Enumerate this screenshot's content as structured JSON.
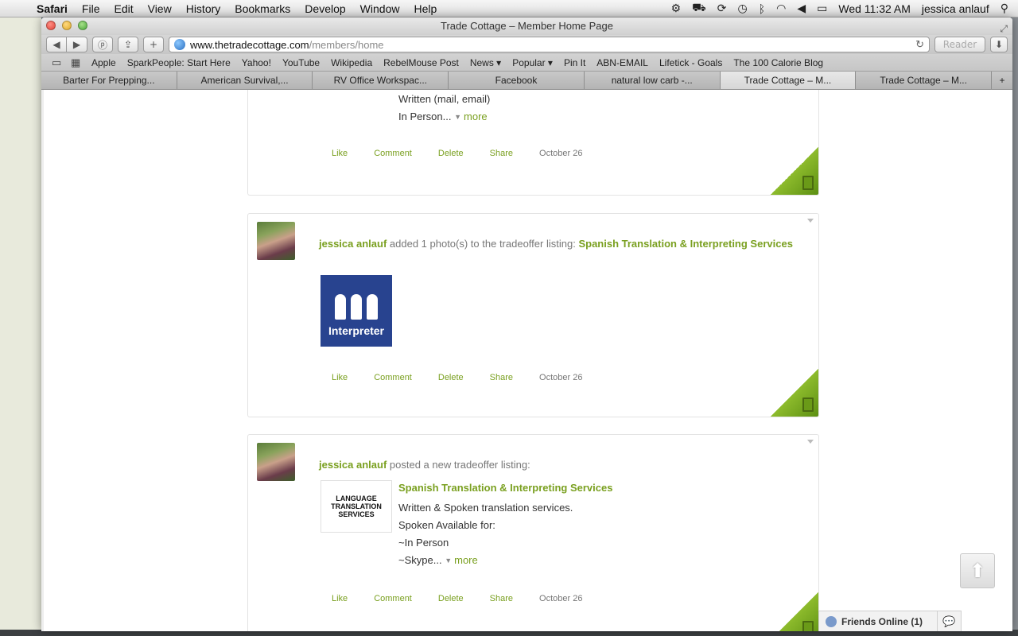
{
  "menubar": {
    "app": "Safari",
    "menus": [
      "File",
      "Edit",
      "View",
      "History",
      "Bookmarks",
      "Develop",
      "Window",
      "Help"
    ],
    "clock": "Wed 11:32 AM",
    "user": "jessica anlauf"
  },
  "window": {
    "title": "Trade Cottage – Member Home Page"
  },
  "toolbar": {
    "url_host": "www.thetradecottage.com",
    "url_path": "/members/home",
    "reader_label": "Reader"
  },
  "bookmarks": [
    "Apple",
    "SparkPeople: Start Here",
    "Yahoo!",
    "YouTube",
    "Wikipedia",
    "RebelMouse Post",
    "News ▾",
    "Popular ▾",
    "Pin It",
    "ABN-EMAIL",
    "Lifetick - Goals",
    "The 100 Calorie Blog"
  ],
  "tabs": [
    "Barter For Prepping...",
    "American Survival,...",
    "RV Office Workspac...",
    "Facebook",
    "natural low carb -...",
    "Trade Cottage – M...",
    "Trade Cottage – M..."
  ],
  "feed": {
    "post1": {
      "lines": [
        "Written (mail, email)",
        "In Person..."
      ],
      "more": "more",
      "actions": {
        "like": "Like",
        "comment": "Comment",
        "delete": "Delete",
        "share": "Share",
        "date": "October 26"
      }
    },
    "post2": {
      "user": "jessica anlauf",
      "verb": "added 1 photo(s) to the tradeoffer listing:",
      "link": "Spanish Translation & Interpreting Services",
      "image_label": "Interpreter",
      "actions": {
        "like": "Like",
        "comment": "Comment",
        "delete": "Delete",
        "share": "Share",
        "date": "October 26"
      }
    },
    "post3": {
      "user": "jessica anlauf",
      "verb": "posted a new tradeoffer listing:",
      "thumb_text": "LANGUAGE TRANSLATION SERVICES",
      "title": "Spanish Translation & Interpreting Services",
      "lines": [
        "Written & Spoken translation services.",
        "Spoken Available for:",
        "~In Person",
        "~Skype..."
      ],
      "more": "more",
      "actions": {
        "like": "Like",
        "comment": "Comment",
        "delete": "Delete",
        "share": "Share",
        "date": "October 26"
      }
    }
  },
  "friends": {
    "label": "Friends Online (1)"
  }
}
